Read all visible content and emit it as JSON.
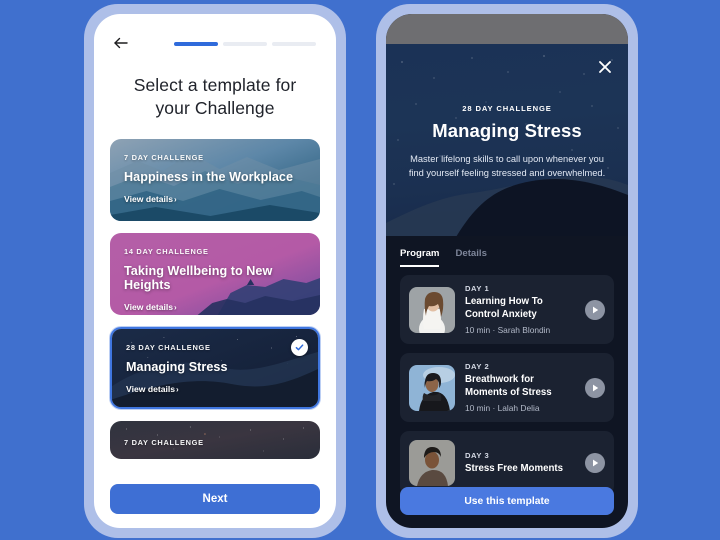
{
  "background_color": "#4070ce",
  "left_screen": {
    "back_icon": "back-arrow-icon",
    "progress": {
      "total_steps": 3,
      "active_step": 1
    },
    "title_line1": "Select a template for",
    "title_line2": "your Challenge",
    "cards": [
      {
        "eyebrow": "7 DAY CHALLENGE",
        "title": "Happiness in the Workplace",
        "link": "View details",
        "chevron": "›",
        "selected": false,
        "theme": "teal-mountains"
      },
      {
        "eyebrow": "14 DAY CHALLENGE",
        "title": "Taking Wellbeing to New Heights",
        "link": "View details",
        "chevron": "›",
        "selected": false,
        "theme": "pink-cliffs"
      },
      {
        "eyebrow": "28 DAY CHALLENGE",
        "title": "Managing Stress",
        "link": "View details",
        "chevron": "›",
        "selected": true,
        "theme": "night-dunes"
      }
    ],
    "partial_card": {
      "eyebrow": "7 DAY CHALLENGE",
      "theme": "starry"
    },
    "next_label": "Next",
    "accent_color": "#3e6fd4",
    "check_color": "#2f6bdb"
  },
  "right_screen": {
    "close_icon": "close-icon",
    "hero_eyebrow": "28 DAY CHALLENGE",
    "hero_title": "Managing Stress",
    "hero_subtitle": "Master lifelong skills to call upon whenever you find yourself feeling stressed and overwhelmed.",
    "tabs": [
      {
        "label": "Program",
        "active": true
      },
      {
        "label": "Details",
        "active": false
      }
    ],
    "program_items": [
      {
        "day": "DAY 1",
        "title_line1": "Learning How To",
        "title_line2": "Control Anxiety",
        "meta": "10 min · Sarah Blondin",
        "play_icon": "play-icon",
        "thumb": "woman-white-top"
      },
      {
        "day": "DAY 2",
        "title_line1": "Breathwork for",
        "title_line2": "Moments of Stress",
        "meta": "10 min · Lalah Delia",
        "play_icon": "play-icon",
        "thumb": "woman-black-turtleneck"
      },
      {
        "day": "DAY 3",
        "title_line1": "Stress Free Moments",
        "title_line2": "",
        "meta": "",
        "play_icon": "play-icon",
        "thumb": "man-portrait"
      }
    ],
    "cta_label": "Use this template",
    "cta_color": "#4a79e0"
  }
}
